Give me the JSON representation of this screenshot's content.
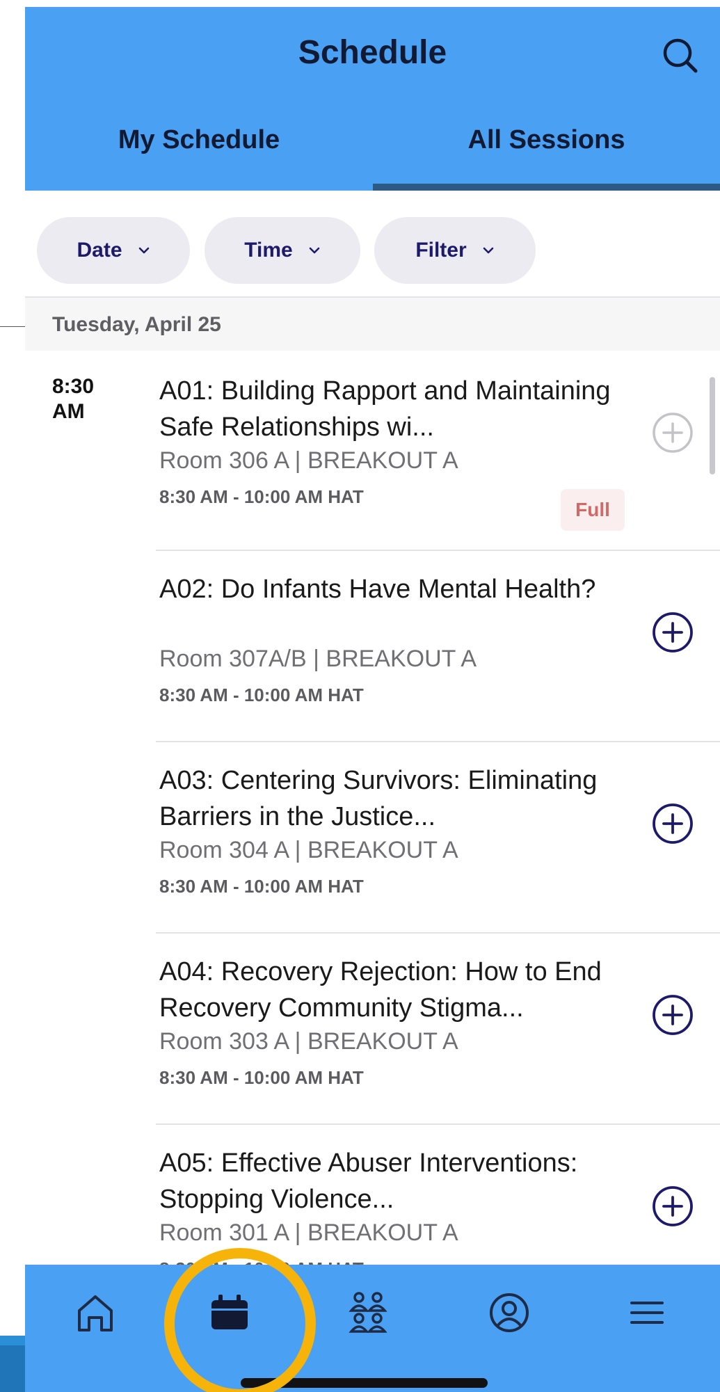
{
  "header": {
    "title": "Schedule"
  },
  "tabs": [
    {
      "label": "My Schedule",
      "selected": false
    },
    {
      "label": "All Sessions",
      "selected": true
    }
  ],
  "filters": {
    "date": "Date",
    "time": "Time",
    "filter": "Filter"
  },
  "date_group": "Tuesday, April 25",
  "time_slot": {
    "line1": "8:30",
    "line2": "AM"
  },
  "sessions": [
    {
      "title": "A01: Building Rapport and Maintaining Safe Relationships wi...",
      "room": "Room 306 A | BREAKOUT A",
      "time": "8:30 AM - 10:00 AM HAT",
      "badge": "Full",
      "add_enabled": false
    },
    {
      "title": "A02: Do Infants Have Mental Health?",
      "room": "Room 307A/B | BREAKOUT A",
      "time": "8:30 AM - 10:00 AM HAT",
      "add_enabled": true
    },
    {
      "title": "A03: Centering Survivors: Eliminating Barriers in the Justice...",
      "room": "Room 304 A | BREAKOUT A",
      "time": "8:30 AM - 10:00 AM HAT",
      "add_enabled": true
    },
    {
      "title": "A04: Recovery Rejection: How to End Recovery Community Stigma...",
      "room": "Room 303 A | BREAKOUT A",
      "time": "8:30 AM - 10:00 AM HAT",
      "add_enabled": true
    },
    {
      "title": "A05: Effective Abuser Interventions: Stopping Violence...",
      "room": "Room 301 A | BREAKOUT A",
      "time": "8:30 AM - 10:00 AM HAT",
      "add_enabled": true
    }
  ],
  "nav": [
    {
      "icon": "home-icon"
    },
    {
      "icon": "calendar-icon",
      "active": true
    },
    {
      "icon": "people-icon"
    },
    {
      "icon": "profile-icon"
    },
    {
      "icon": "menu-icon"
    }
  ],
  "colors": {
    "header_bg": "#4aa0f3",
    "accent_dark": "#1d1a6a",
    "highlight_ring": "#f6b40b",
    "full_badge_text": "#d06a66"
  }
}
